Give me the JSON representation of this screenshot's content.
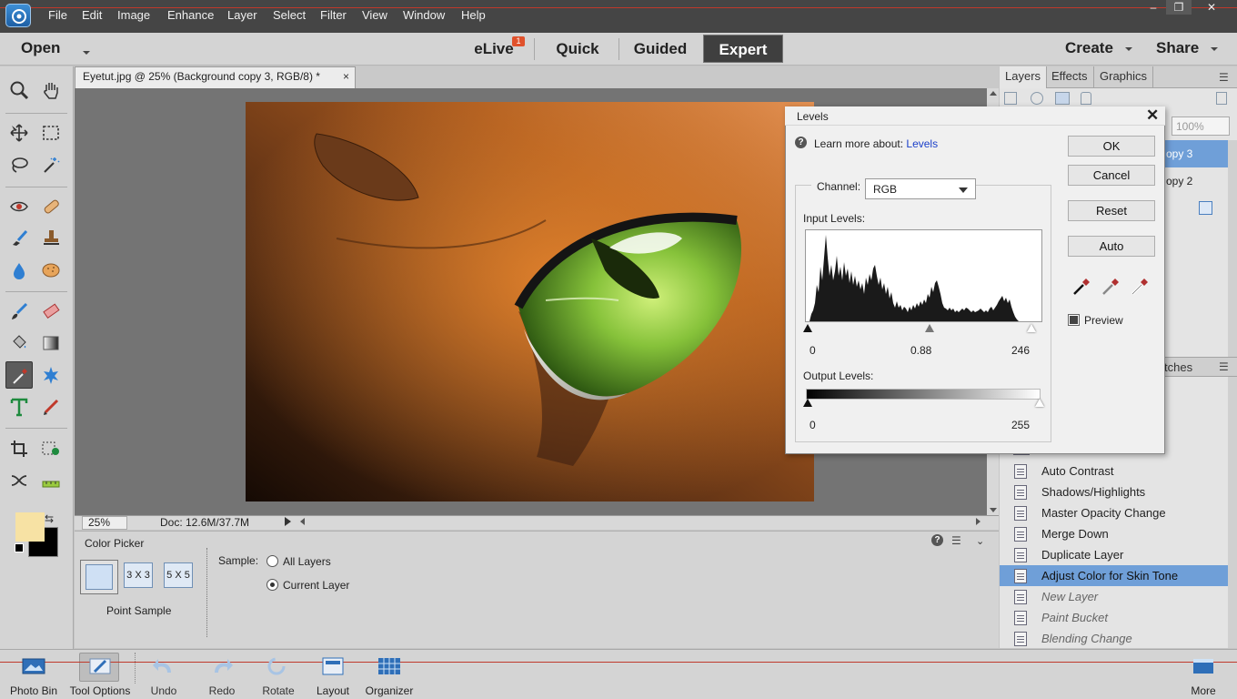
{
  "menu": {
    "items": [
      "File",
      "Edit",
      "Image",
      "Enhance",
      "Layer",
      "Select",
      "Filter",
      "View",
      "Window",
      "Help"
    ],
    "window_controls": [
      "–",
      "❐",
      "✕"
    ]
  },
  "modes": {
    "open_label": "Open",
    "tabs": [
      "eLive",
      "Quick",
      "Guided",
      "Expert"
    ],
    "elive_badge": "1",
    "create_label": "Create",
    "share_label": "Share",
    "active_tab": "Expert"
  },
  "document": {
    "tab_title": "Eyetut.jpg @ 25% (Background copy 3, RGB/8) *",
    "close_glyph": "×",
    "zoom": "25%",
    "doc_size": "Doc: 12.6M/37.7M"
  },
  "tool_options": {
    "title": "Color Picker",
    "sizes": [
      "3 X 3",
      "5 X 5"
    ],
    "point_sample_label": "Point Sample",
    "sample_label": "Sample:",
    "sample_options": [
      "All Layers",
      "Current Layer"
    ],
    "sample_selected": "Current Layer"
  },
  "panels": {
    "tabs": [
      "Layers",
      "Effects",
      "Graphics"
    ],
    "opacity": "100%",
    "layer_rows": [
      "opy 3",
      "opy 2"
    ],
    "history_tab_partial": "tches",
    "history": [
      {
        "label": "Auto Contrast",
        "state": "past"
      },
      {
        "label": "Shadows/Highlights",
        "state": "past"
      },
      {
        "label": "Master Opacity Change",
        "state": "past"
      },
      {
        "label": "Merge Down",
        "state": "past"
      },
      {
        "label": "Duplicate Layer",
        "state": "past"
      },
      {
        "label": "Adjust Color for Skin Tone",
        "state": "selected"
      },
      {
        "label": "New Layer",
        "state": "future"
      },
      {
        "label": "Paint Bucket",
        "state": "future"
      },
      {
        "label": "Blending Change",
        "state": "future"
      }
    ]
  },
  "levels": {
    "title": "Levels",
    "learn_more_prefix": "Learn more about:",
    "learn_more_link": "Levels",
    "buttons": {
      "ok": "OK",
      "cancel": "Cancel",
      "reset": "Reset",
      "auto": "Auto"
    },
    "channel_label": "Channel:",
    "channel_value": "RGB",
    "input_levels_label": "Input Levels:",
    "input_values": {
      "black": "0",
      "gamma": "0.88",
      "white": "246"
    },
    "output_levels_label": "Output Levels:",
    "output_values": {
      "black": "0",
      "white": "255"
    },
    "preview_label": "Preview",
    "preview_checked": true
  },
  "bottom_bar": {
    "items": [
      "Photo Bin",
      "Tool Options",
      "Undo",
      "Redo",
      "Rotate",
      "Layout",
      "Organizer"
    ],
    "more_label": "More"
  },
  "colors": {
    "accent_blue": "#6f9fd8",
    "foreground_color": "#f7e2a4",
    "background_color": "#000000",
    "link_blue": "#1a3fc9"
  }
}
